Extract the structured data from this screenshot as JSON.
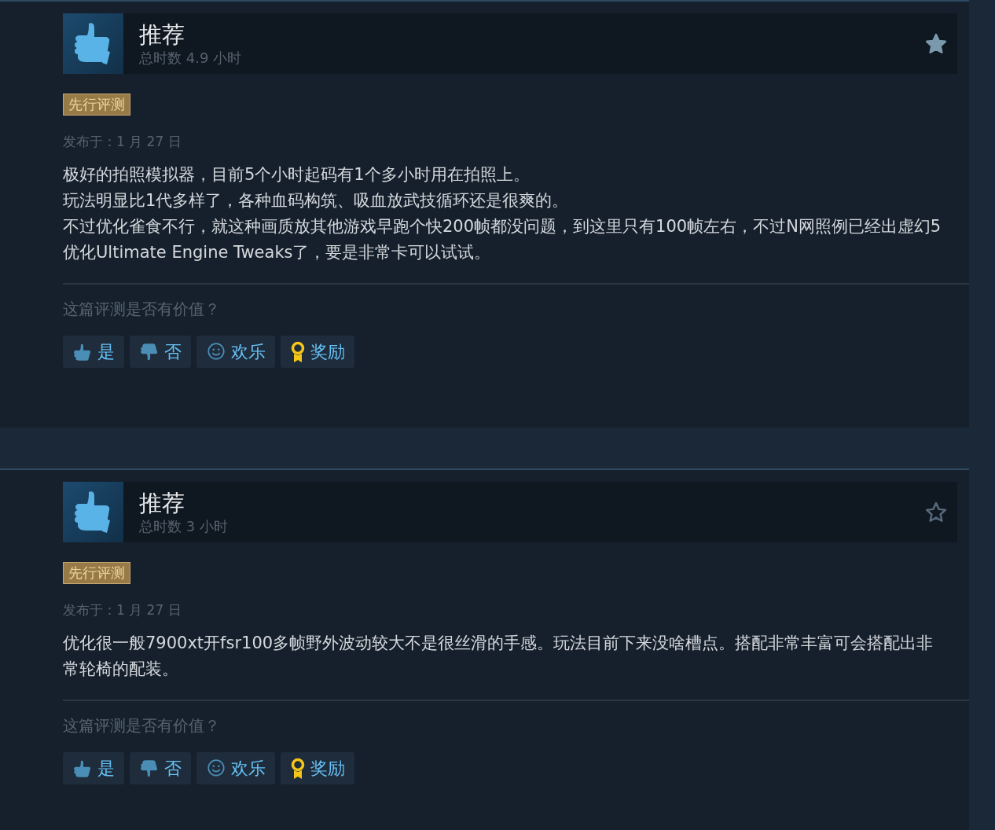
{
  "reviews": [
    {
      "verdict": "推荐",
      "hours": "总时数 4.9 小时",
      "starred": true,
      "badge": "先行评测",
      "posted": "发布于：1 月 27 日",
      "paragraphs": [
        "极好的拍照模拟器，目前5个小时起码有1个多小时用在拍照上。",
        "玩法明显比1代多样了，各种血码构筑、吸血放武技循环还是很爽的。",
        "不过优化雀食不行，就这种画质放其他游戏早跑个快200帧都没问题，到这里只有100帧左右，不过N网照例已经出虚幻5优化Ultimate Engine Tweaks了，要是非常卡可以试试。"
      ],
      "question": "这篇评测是否有价值？",
      "buttons": [
        {
          "kind": "yes",
          "label": "是"
        },
        {
          "kind": "no",
          "label": "否"
        },
        {
          "kind": "funny",
          "label": "欢乐"
        },
        {
          "kind": "award",
          "label": "奖励"
        }
      ]
    },
    {
      "verdict": "推荐",
      "hours": "总时数 3 小时",
      "starred": false,
      "badge": "先行评测",
      "posted": "发布于：1 月 27 日",
      "paragraphs": [
        "优化很一般7900xt开fsr100多帧野外波动较大不是很丝滑的手感。玩法目前下来没啥槽点。搭配非常丰富可会搭配出非常轮椅的配装。"
      ],
      "question": "这篇评测是否有价值？",
      "buttons": [
        {
          "kind": "yes",
          "label": "是"
        },
        {
          "kind": "no",
          "label": "否"
        },
        {
          "kind": "funny",
          "label": "欢乐"
        },
        {
          "kind": "award",
          "label": "奖励"
        }
      ]
    }
  ]
}
